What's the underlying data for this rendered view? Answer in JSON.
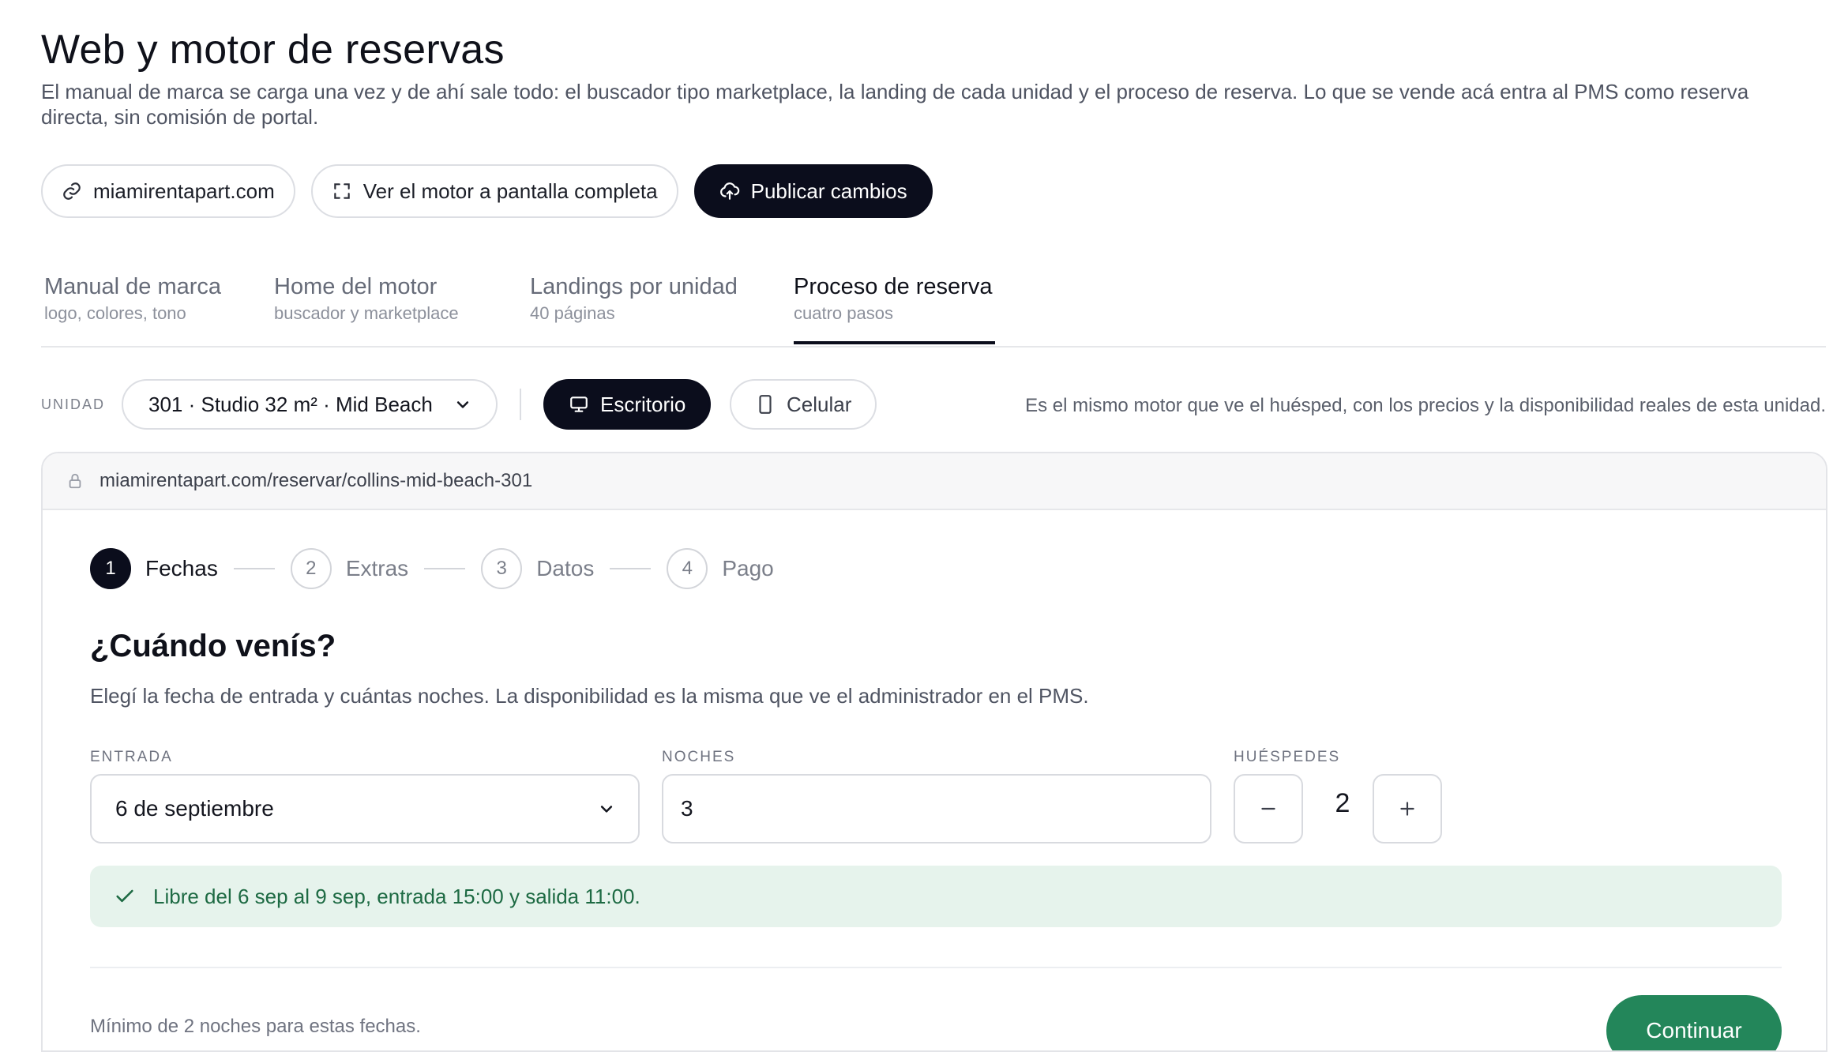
{
  "header": {
    "title": "Web y motor de reservas",
    "subtitle": "El manual de marca se carga una vez y de ahí sale todo: el buscador tipo marketplace, la landing de cada unidad y el proceso de reserva. Lo que se vende acá entra al PMS como reserva directa, sin comisión de portal."
  },
  "actions": {
    "domain": "miamirentapart.com",
    "fullscreen": "Ver el motor a pantalla completa",
    "publish": "Publicar cambios"
  },
  "tabs": [
    {
      "title": "Manual de marca",
      "sub": "logo, colores, tono"
    },
    {
      "title": "Home del motor",
      "sub": "buscador y marketplace"
    },
    {
      "title": "Landings por unidad",
      "sub": "40 páginas"
    },
    {
      "title": "Proceso de reserva",
      "sub": "cuatro pasos"
    }
  ],
  "unit": {
    "label": "UNIDAD",
    "selected": "301 · Studio 32 m² · Mid Beach",
    "desktop": "Escritorio",
    "mobile": "Celular",
    "note": "Es el mismo motor que ve el huésped, con los precios y la disponibilidad reales de esta unidad."
  },
  "browser": {
    "url": "miamirentapart.com/reservar/collins-mid-beach-301"
  },
  "steps": [
    {
      "num": "1",
      "label": "Fechas"
    },
    {
      "num": "2",
      "label": "Extras"
    },
    {
      "num": "3",
      "label": "Datos"
    },
    {
      "num": "4",
      "label": "Pago"
    }
  ],
  "booking": {
    "question": "¿Cuándo venís?",
    "description": "Elegí la fecha de entrada y cuántas noches. La disponibilidad es la misma que ve el administrador en el PMS.",
    "checkin_label": "ENTRADA",
    "checkin_value": "6 de septiembre",
    "nights_label": "NOCHES",
    "nights_value": "3",
    "guests_label": "HUÉSPEDES",
    "guests_value": "2",
    "availability": "Libre del 6 sep al 9 sep, entrada 15:00 y salida 11:00.",
    "min_note": "Mínimo de 2 noches para estas fechas.",
    "continue": "Continuar"
  },
  "colors": {
    "primary": "#0b0d1c",
    "success_bg": "#e6f3ec",
    "success_text": "#1d6a43",
    "continue": "#23865a"
  }
}
